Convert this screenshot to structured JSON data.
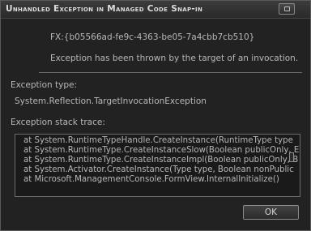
{
  "dialog": {
    "title": "Unhandled Exception in Managed Code Snap-in",
    "guid": "FX:{b05566ad-fe9c-4363-be05-7a4cbb7cb510}",
    "message": "Exception has been thrown by the target of an invocation.",
    "exception_type_label": "Exception type:",
    "exception_type_value": "System.Reflection.TargetInvocationException",
    "stack_trace_label": "Exception stack trace:",
    "stack_trace": [
      "at System.RuntimeTypeHandle.CreateInstance(RuntimeType type",
      "at System.RuntimeType.CreateInstanceSlow(Boolean publicOnly, E",
      "at System.RuntimeType.CreateInstanceImpl(Boolean publicOnly, B",
      "at System.Activator.CreateInstance(Type type, Boolean nonPublic",
      "at Microsoft.ManagementConsole.FormView.InternalInitialize()"
    ],
    "ok_label": "OK"
  }
}
